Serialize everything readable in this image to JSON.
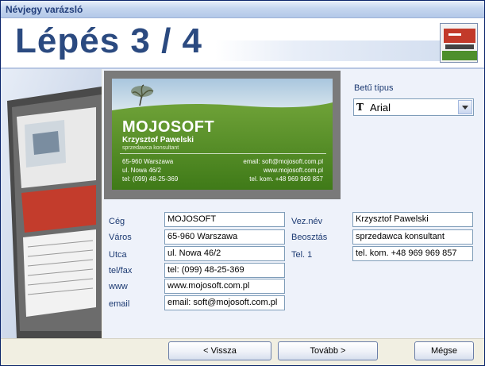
{
  "window": {
    "title": "Névjegy varázsló"
  },
  "header": {
    "step": "Lépés 3 / 4"
  },
  "card": {
    "company": "MOJOSOFT",
    "person": "Krzysztof Pawelski",
    "role": "sprzedawca konsultant",
    "left_lines": [
      "65-960 Warszawa",
      "ul. Nowa 46/2",
      "tel: (099) 48-25-369"
    ],
    "right_lines": [
      "email: soft@mojosoft.com.pl",
      "www.mojosoft.com.pl",
      "tel. kom. +48 969 969 857"
    ]
  },
  "font": {
    "label": "Betű típus",
    "value": "Arial"
  },
  "form": {
    "left": [
      {
        "label": "Cég",
        "value": "MOJOSOFT"
      },
      {
        "label": "Város",
        "value": "65-960 Warszawa"
      },
      {
        "label": "Utca",
        "value": "ul. Nowa 46/2"
      },
      {
        "label": "tel/fax",
        "value": "tel: (099) 48-25-369"
      },
      {
        "label": "www",
        "value": "www.mojosoft.com.pl"
      },
      {
        "label": "email",
        "value": "email: soft@mojosoft.com.pl"
      }
    ],
    "right": [
      {
        "label": "Vez.név",
        "value": "Krzysztof Pawelski"
      },
      {
        "label": "Beosztás",
        "value": "sprzedawca konsultant"
      },
      {
        "label": "Tel. 1",
        "value": "tel. kom. +48 969 969 857"
      }
    ]
  },
  "buttons": {
    "back": "< Vissza",
    "next": "Tovább >",
    "cancel": "Mégse"
  },
  "colors": {
    "heading": "#2b4a80",
    "label": "#1c3a72",
    "card_grass": "#4f8a1f",
    "card_sky": "#c9dcea"
  },
  "icons": {
    "font_type": "truetype-font-icon",
    "dropdown": "chevron-down-icon"
  }
}
